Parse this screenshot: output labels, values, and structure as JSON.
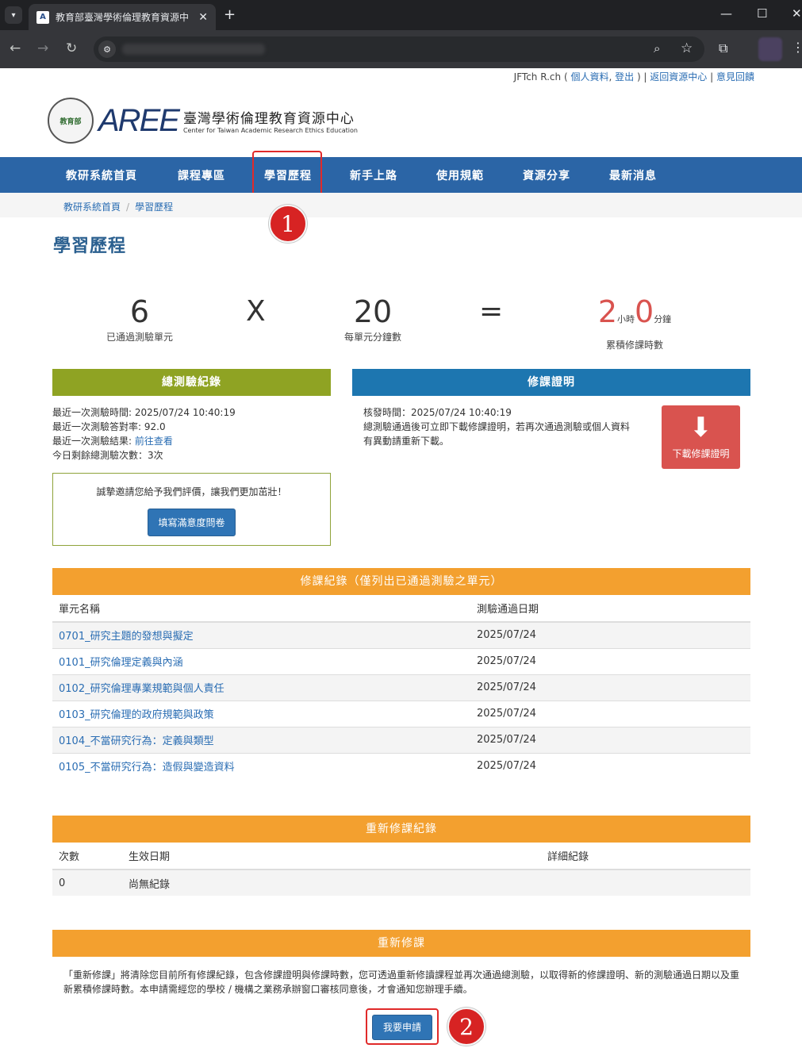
{
  "browser": {
    "tab_title": "教育部臺灣學術倫理教育資源中",
    "tab_close": "✕",
    "newtab": "+"
  },
  "header": {
    "user_name": "JFTch R.ch",
    "profile_link": "個人資料",
    "logout_link": "登出",
    "back_link": "返回資源中心",
    "feedback_link": "意見回饋",
    "seal_text": "教育部",
    "logo_mark": "AREE",
    "logo_zh": "臺灣學術倫理教育資源中心",
    "logo_en": "Center for Taiwan Academic Research Ethics Education"
  },
  "nav": {
    "items": [
      "教研系統首頁",
      "課程專區",
      "學習歷程",
      "新手上路",
      "使用規範",
      "資源分享",
      "最新消息"
    ]
  },
  "breadcrumb": {
    "home": "教研系統首頁",
    "current": "學習歷程"
  },
  "annotations": {
    "one": "1",
    "two": "2"
  },
  "page_title": "學習歷程",
  "stats": {
    "units_passed": "6",
    "units_passed_label": "已通過測驗單元",
    "times": "X",
    "minutes_per_unit": "20",
    "minutes_per_unit_label": "每單元分鐘數",
    "equals": "=",
    "hours": "2",
    "hours_unit": "小時",
    "minutes": "0",
    "minutes_unit": "分鐘",
    "total_label": "累積修課時數"
  },
  "test_record": {
    "title": "總測驗紀錄",
    "last_time": "最近一次測驗時間: 2025/07/24 10:40:19",
    "last_rate": "最近一次測驗答對率: 92.0",
    "last_result_label": "最近一次測驗結果: ",
    "last_result_link": "前往查看",
    "remaining": "今日剩餘總測驗次數：3次",
    "survey_text": "誠摯邀請您給予我們評價，讓我們更加茁壯！",
    "survey_button": "填寫滿意度問卷"
  },
  "certificate": {
    "title": "修課證明",
    "issue_time": "核發時間：2025/07/24 10:40:19",
    "note": "總測驗通過後可立即下載修課證明，若再次通過測驗或個人資料有異動請重新下載。",
    "download_button": "下載修課證明"
  },
  "course_record": {
    "title": "修課紀錄（僅列出已通過測驗之單元）",
    "col_unit": "單元名稱",
    "col_date": "測驗通過日期",
    "rows": [
      {
        "unit": "0701_研究主題的發想與擬定",
        "date": "2025/07/24"
      },
      {
        "unit": "0101_研究倫理定義與內涵",
        "date": "2025/07/24"
      },
      {
        "unit": "0102_研究倫理專業規範與個人責任",
        "date": "2025/07/24"
      },
      {
        "unit": "0103_研究倫理的政府規範與政策",
        "date": "2025/07/24"
      },
      {
        "unit": "0104_不當研究行為：定義與類型",
        "date": "2025/07/24"
      },
      {
        "unit": "0105_不當研究行為：造假與變造資料",
        "date": "2025/07/24"
      }
    ]
  },
  "retake_record": {
    "title": "重新修課紀錄",
    "col_count": "次數",
    "col_date": "生效日期",
    "col_detail": "詳細紀錄",
    "row_count": "0",
    "row_date": "尚無紀錄"
  },
  "retake": {
    "title": "重新修課",
    "description": "「重新修課」將清除您目前所有修課紀錄，包含修課證明與修課時數，您可透過重新修讀課程並再次通過總測驗，以取得新的修課證明、新的測驗通過日期以及重新累積修課時數。本申請需經您的學校 / 機構之業務承辦窗口審核同意後，才會通知您辦理手續。",
    "apply_button": "我要申請"
  },
  "colors": {
    "nav": "#2b65a6",
    "green": "#8fa323",
    "blue": "#1d76b0",
    "orange": "#f3a02f",
    "red": "#d9534f"
  },
  "icons": [
    "dropdown-icon",
    "close-icon",
    "back-icon",
    "forward-icon",
    "reload-icon",
    "site-info-icon",
    "zoom-icon",
    "star-icon",
    "extensions-icon",
    "menu-icon",
    "download-icon"
  ]
}
